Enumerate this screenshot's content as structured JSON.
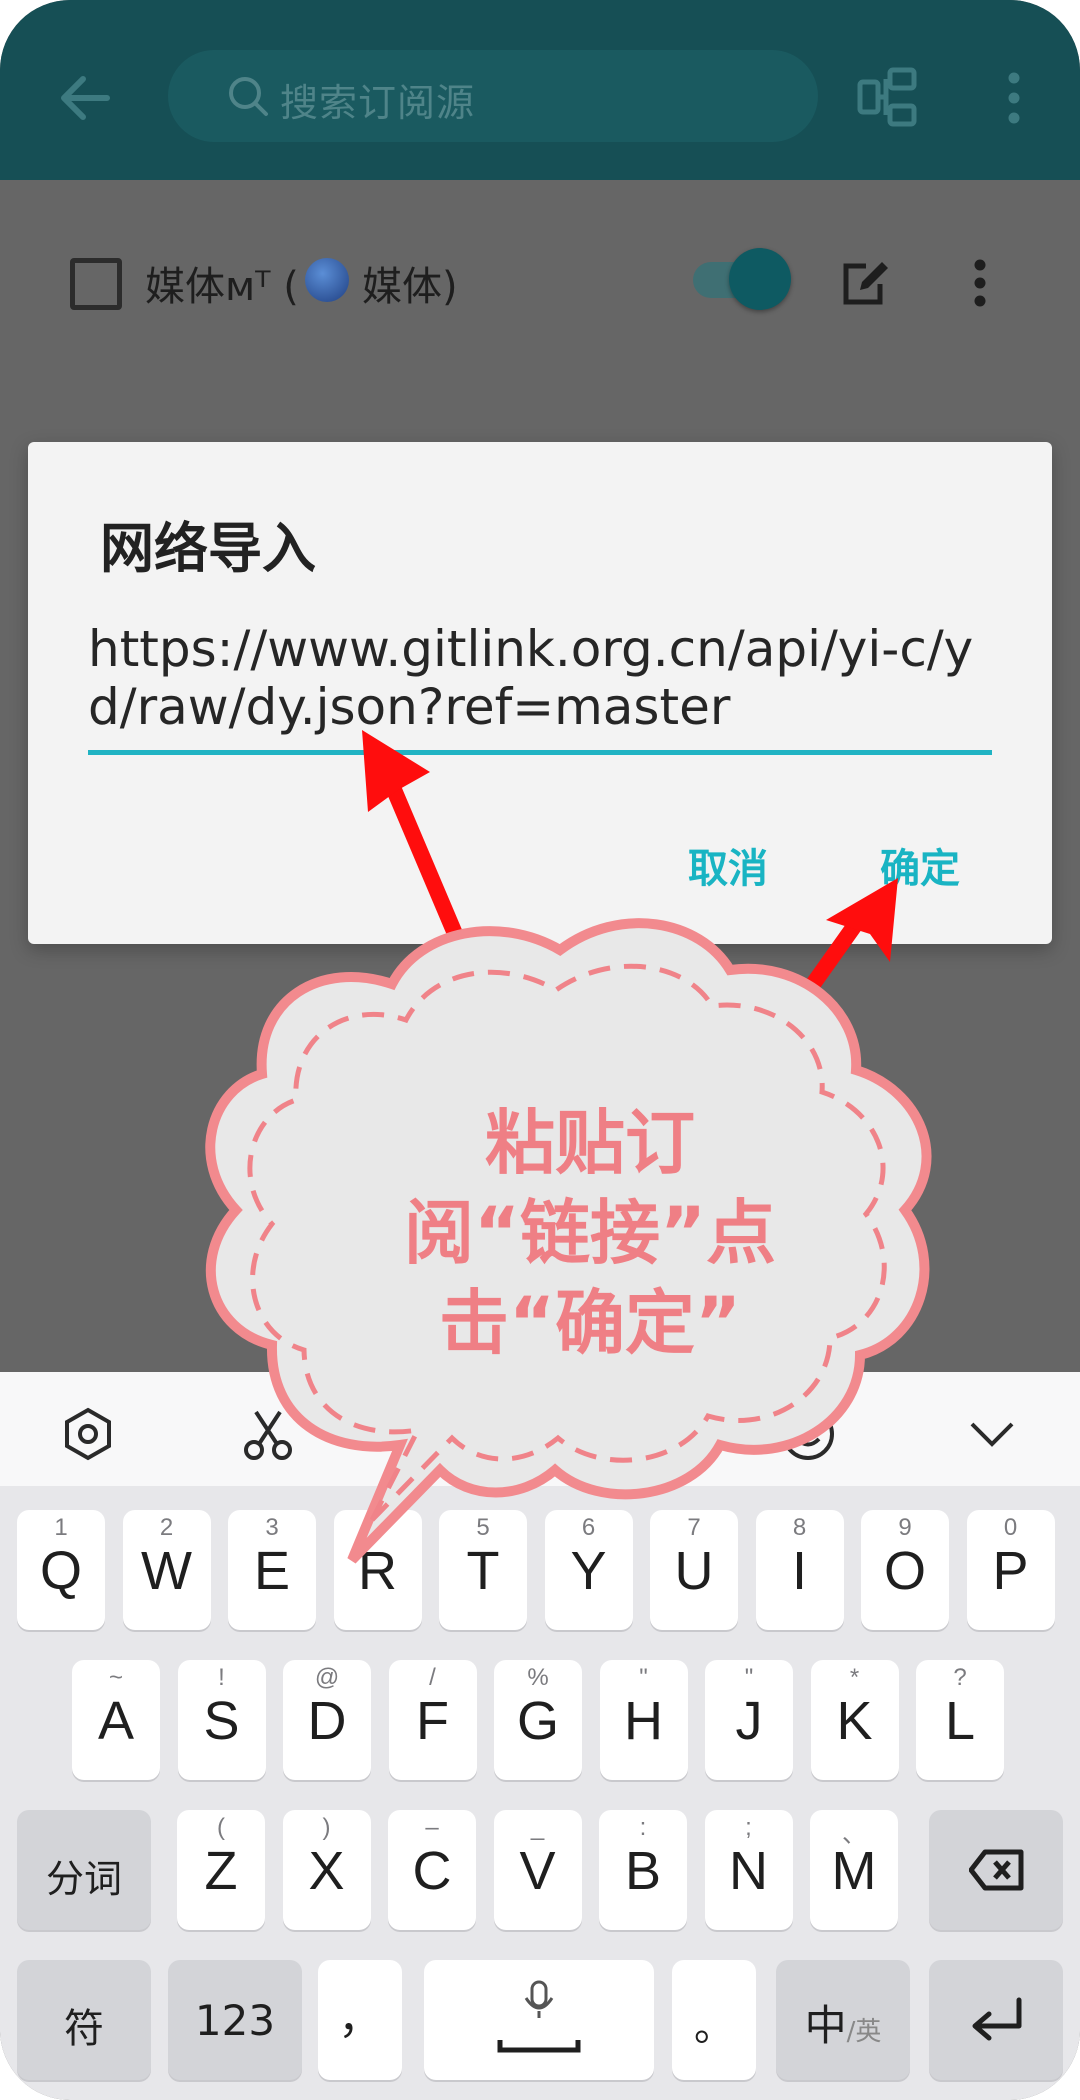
{
  "appbar": {
    "search_placeholder": "搜索订阅源"
  },
  "row": {
    "label": "媒体ᴍᵀ (",
    "label_suffix": "媒体)"
  },
  "dialog": {
    "title": "网络导入",
    "input_value": "https://www.gitlink.org.cn/api/yi-c/yd/raw/dy.json?ref=master",
    "cancel_label": "取消",
    "ok_label": "确定"
  },
  "annotation": {
    "lines": [
      "粘贴订",
      "阅“链接”点",
      "击“确定”"
    ]
  },
  "keyboard": {
    "row1": [
      {
        "k": "Q",
        "s": "1"
      },
      {
        "k": "W",
        "s": "2"
      },
      {
        "k": "E",
        "s": "3"
      },
      {
        "k": "R",
        "s": "4"
      },
      {
        "k": "T",
        "s": "5"
      },
      {
        "k": "Y",
        "s": "6"
      },
      {
        "k": "U",
        "s": "7"
      },
      {
        "k": "I",
        "s": "8"
      },
      {
        "k": "O",
        "s": "9"
      },
      {
        "k": "P",
        "s": "0"
      }
    ],
    "row2": [
      {
        "k": "A",
        "s": "~"
      },
      {
        "k": "S",
        "s": "!"
      },
      {
        "k": "D",
        "s": "@"
      },
      {
        "k": "F",
        "s": "/"
      },
      {
        "k": "G",
        "s": "%"
      },
      {
        "k": "H",
        "s": "\""
      },
      {
        "k": "J",
        "s": "\""
      },
      {
        "k": "K",
        "s": "*"
      },
      {
        "k": "L",
        "s": "?"
      }
    ],
    "row3": [
      {
        "k": "Z",
        "s": "("
      },
      {
        "k": "X",
        "s": ")"
      },
      {
        "k": "C",
        "s": "–"
      },
      {
        "k": "V",
        "s": "_"
      },
      {
        "k": "B",
        "s": ":"
      },
      {
        "k": "N",
        "s": ";"
      },
      {
        "k": "M",
        "s": "、"
      }
    ],
    "segment_label": "分词",
    "symbol_label": "符",
    "num_label": "123",
    "comma_label": "，",
    "period_label": "。",
    "lang_label": "中",
    "lang_sub_label": "/英"
  },
  "colors": {
    "appbar": "#164f55",
    "accent": "#19b4c3",
    "arrow": "#ff0d0d",
    "bubble_text": "#ef7f85"
  }
}
